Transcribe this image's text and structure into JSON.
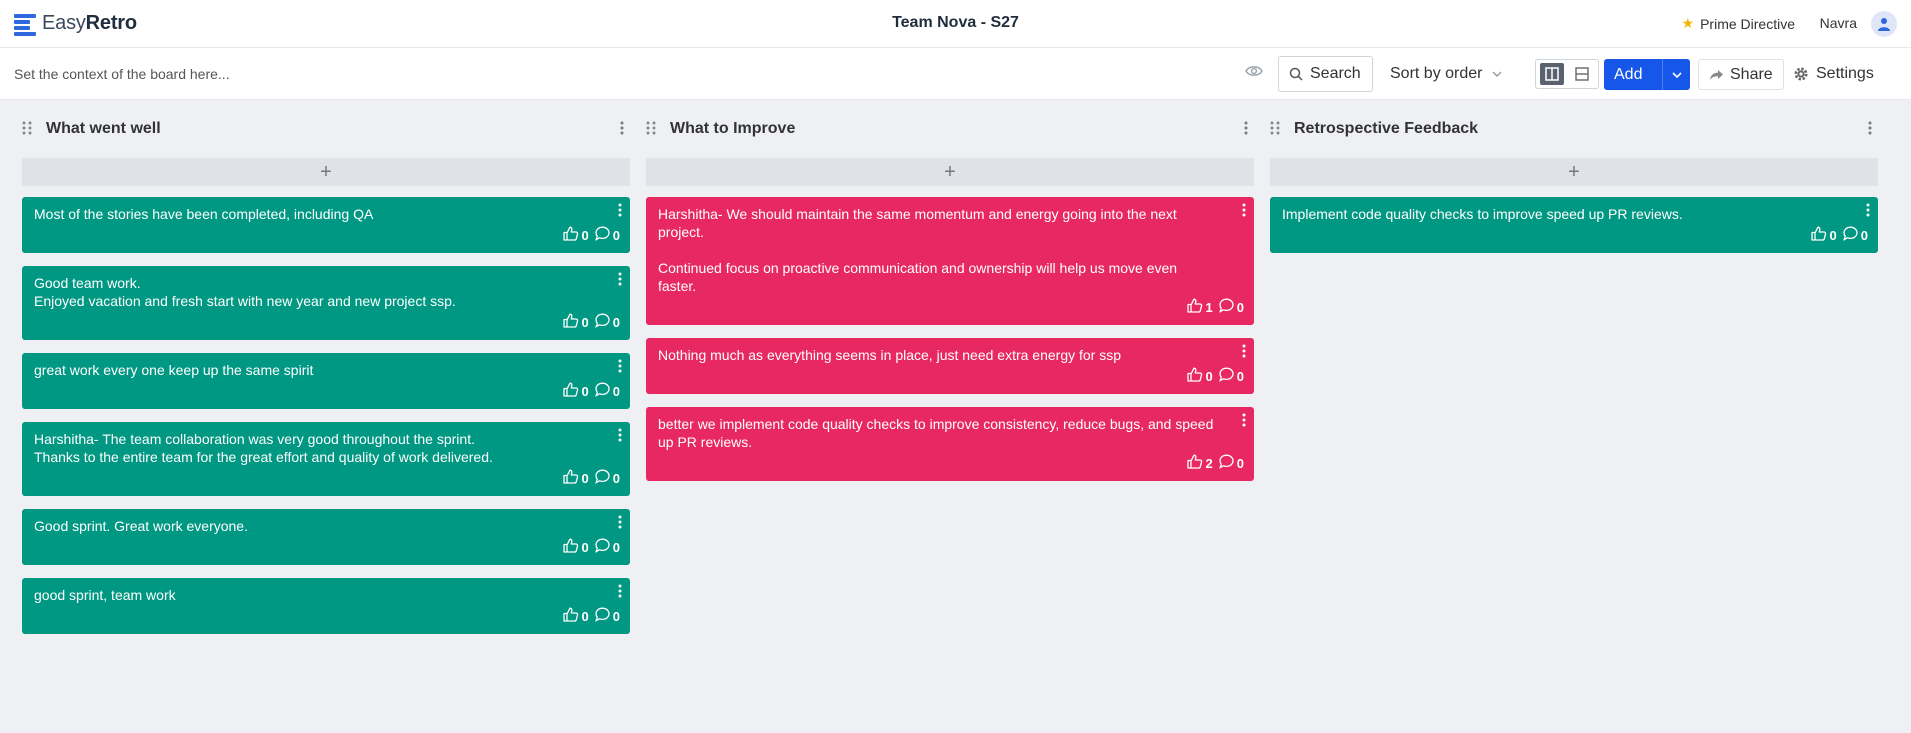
{
  "app": {
    "logo_light": "Easy",
    "logo_bold": "Retro",
    "board_title": "Team Nova - S27",
    "prime_directive": "Prime Directive",
    "user_name": "Navra"
  },
  "toolbar": {
    "context_placeholder": "Set the context of the board here...",
    "search_label": "Search",
    "sort_label": "Sort by order",
    "add_label": "Add",
    "share_label": "Share",
    "settings_label": "Settings"
  },
  "colors": {
    "green": "#009882",
    "pink": "#e82961",
    "accent": "#1656e8"
  },
  "columns": [
    {
      "title": "What went well",
      "cards": [
        {
          "text": "Most of the stories have been completed, including QA",
          "likes": "0",
          "comments": "0"
        },
        {
          "text": "Good team work.\nEnjoyed vacation and fresh start with new year and new project ssp.",
          "likes": "0",
          "comments": "0"
        },
        {
          "text": "great work every one keep up the same spirit",
          "likes": "0",
          "comments": "0"
        },
        {
          "text": "Harshitha- The team collaboration was very good throughout the sprint.\nThanks to the entire team for the great effort and quality of work delivered.",
          "likes": "0",
          "comments": "0"
        },
        {
          "text": "Good sprint. Great work everyone.",
          "likes": "0",
          "comments": "0"
        },
        {
          "text": "good sprint, team work",
          "likes": "0",
          "comments": "0"
        }
      ]
    },
    {
      "title": "What to Improve",
      "cards": [
        {
          "text": "Harshitha- We should maintain the same momentum and energy going into the next project.\n\nContinued focus on proactive communication and ownership will help us move even faster.",
          "likes": "1",
          "comments": "0"
        },
        {
          "text": "Nothing much as everything seems in place, just need extra energy for ssp",
          "likes": "0",
          "comments": "0"
        },
        {
          "text": "better we implement code quality checks to improve consistency, reduce bugs, and speed up PR reviews.",
          "likes": "2",
          "comments": "0"
        }
      ]
    },
    {
      "title": "Retrospective Feedback",
      "cards": [
        {
          "text": "Implement code quality checks to improve speed up PR reviews.",
          "likes": "0",
          "comments": "0"
        }
      ]
    }
  ]
}
